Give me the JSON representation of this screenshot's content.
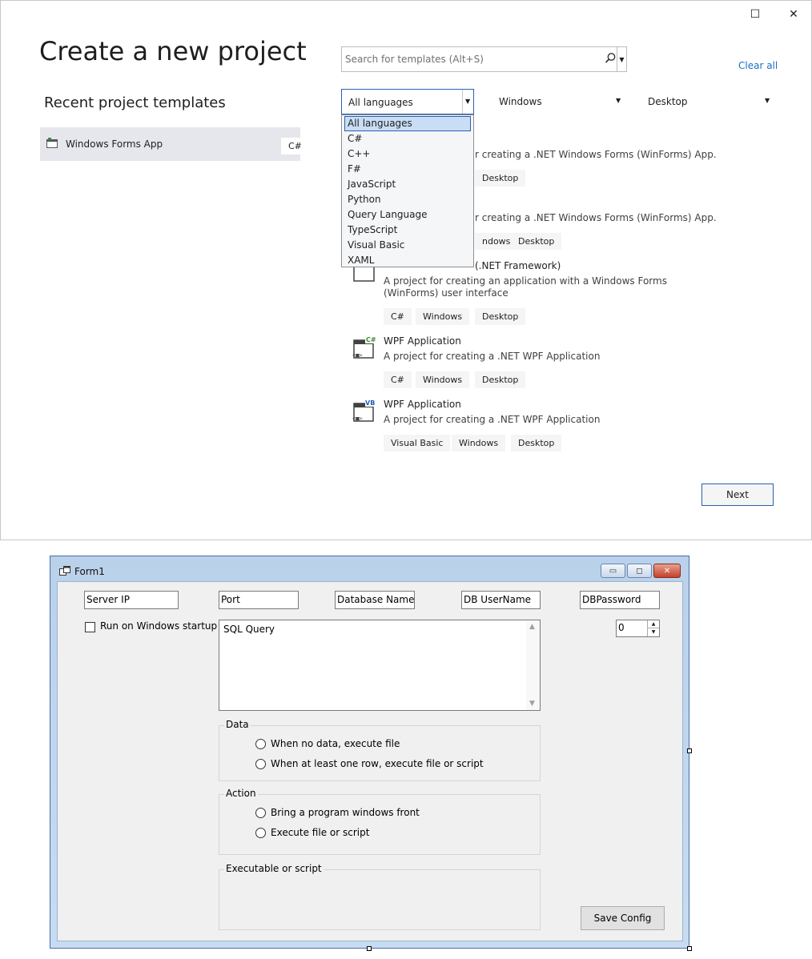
{
  "dialog": {
    "title": "Create a new project",
    "window_controls": {
      "maximize": "☐",
      "close": "✕"
    },
    "recent_title": "Recent project templates",
    "recent_items": [
      {
        "label": "Windows Forms App",
        "tag": "C#"
      }
    ],
    "search": {
      "placeholder": "Search for templates (Alt+S)",
      "value": ""
    },
    "clear_all": "Clear all",
    "filters": {
      "language": "All languages",
      "platform": "Windows",
      "project_type": "Desktop"
    },
    "language_options": [
      "All languages",
      "C#",
      "C++",
      "F#",
      "JavaScript",
      "Python",
      "Query Language",
      "TypeScript",
      "Visual Basic",
      "XAML"
    ],
    "templates": [
      {
        "desc_partial": "r creating a .NET Windows Forms (WinForms) App.",
        "tags_partial": [
          "Desktop"
        ]
      },
      {
        "desc_partial": "r creating a .NET Windows Forms (WinForms) App.",
        "tags_partial": [
          "ndows",
          "Desktop"
        ]
      },
      {
        "name": "Windows Forms App (.NET Framework)",
        "name_partial": "(.NET Framework)",
        "desc": "A project for creating an application with a Windows Forms (WinForms) user interface",
        "tags": [
          "C#",
          "Windows",
          "Desktop"
        ]
      },
      {
        "name": "WPF Application",
        "badge": "C#",
        "desc": "A project for creating a .NET WPF Application",
        "tags": [
          "C#",
          "Windows",
          "Desktop"
        ]
      },
      {
        "name": "WPF Application",
        "badge": "VB",
        "desc": "A project for creating a .NET WPF Application",
        "tags": [
          "Visual Basic",
          "Windows",
          "Desktop"
        ]
      }
    ],
    "next_button": "Next"
  },
  "form": {
    "title": "Form1",
    "caption_buttons": {
      "minimize": "▭",
      "maximize": "◻",
      "close": "✕"
    },
    "fields": {
      "server_ip": "Server IP",
      "port": "Port",
      "database_name": "Database Name",
      "db_username": "DB UserName",
      "db_password": "DBPassword"
    },
    "startup_checkbox_label": "Run on Windows startup",
    "sql_query": "SQL Query",
    "numeric_value": "0",
    "groups": {
      "data": {
        "title": "Data",
        "options": [
          "When no data, execute file",
          "When at least one row, execute file or script"
        ]
      },
      "action": {
        "title": "Action",
        "options": [
          "Bring a program windows front",
          "Execute file or script"
        ]
      },
      "executable": {
        "title": "Executable or script"
      }
    },
    "save_button": "Save Config"
  },
  "colors": {
    "accent": "#2c5fb0",
    "link": "#1a6fc1",
    "recent_bg": "#e6e7ed",
    "form_frame": "#b9d1ea",
    "form_client": "#f0f0f0"
  }
}
